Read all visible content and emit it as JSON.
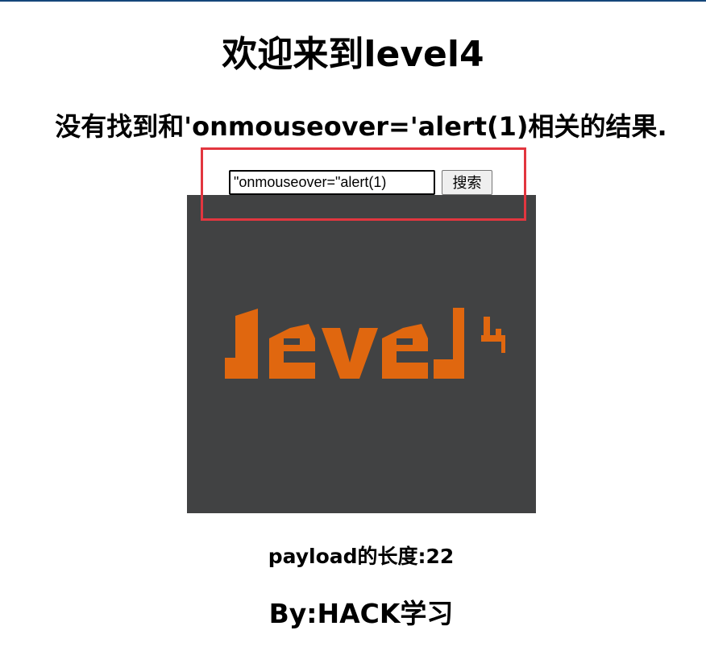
{
  "page": {
    "title": "欢迎来到level4",
    "result_heading": "没有找到和'onmouseover='alert(1)相关的结果.",
    "payload_length": "payload的长度:22",
    "footer": "By:HACK学习"
  },
  "search": {
    "input_value": "\"onmouseover=\"alert(1)",
    "button_label": "搜索"
  },
  "image": {
    "logo_text": "level",
    "logo_superscript": "4",
    "background_color": "#414243",
    "logo_color": "#e0670f"
  },
  "annotation": {
    "highlight_color": "#e2363f"
  }
}
